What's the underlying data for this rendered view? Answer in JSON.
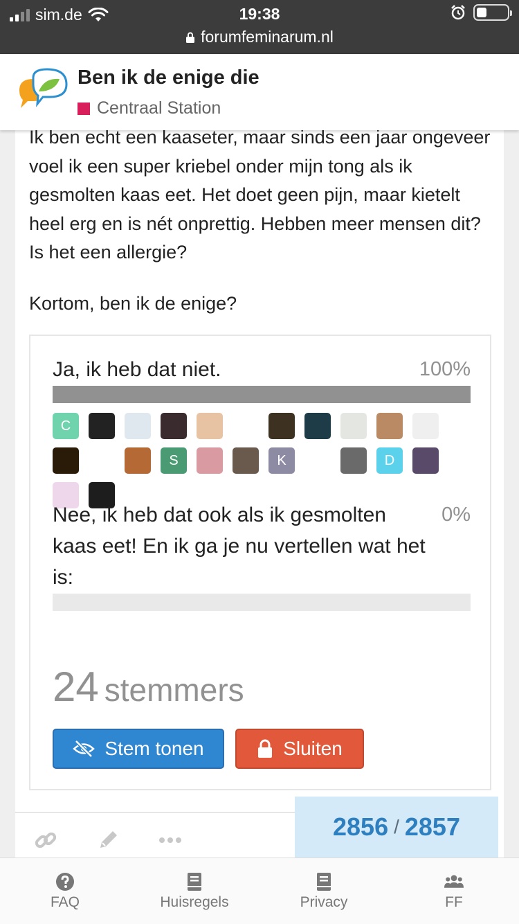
{
  "status_bar": {
    "carrier": "sim.de",
    "time": "19:38",
    "url": "forumfeminarum.nl"
  },
  "topic": {
    "title": "Ben ik de enige die",
    "category": "Centraal Station",
    "category_color": "#d81e5b"
  },
  "post": {
    "paragraph_1": "Ik ben echt een kaaseter, maar sinds een jaar ongeveer voel ik een super kriebel onder mijn tong als ik gesmolten kaas eet. Het doet geen pijn, maar kietelt heel erg en is nét onprettig. Hebben meer mensen dit? Is het een allergie?",
    "paragraph_2": "Kortom, ben ik de enige?"
  },
  "poll": {
    "options": [
      {
        "label": "Ja, ik heb dat niet.",
        "percent_text": "100%",
        "percent": 100
      },
      {
        "label": "Nee, ik heb dat ook als ik gesmolten kaas eet! En ik ga je nu vertellen wat het is:",
        "percent_text": "0%",
        "percent": 0
      }
    ],
    "voters": [
      {
        "letter": "C",
        "color": "#6fd3ad"
      },
      {
        "letter": "",
        "color": "#222222"
      },
      {
        "letter": "",
        "color": "#dfe7ef"
      },
      {
        "letter": "",
        "color": "#3a2c2e"
      },
      {
        "letter": "",
        "color": "#e7c3a3"
      },
      {
        "letter": "",
        "color": "#ffffff"
      },
      {
        "letter": "",
        "color": "#3d3222"
      },
      {
        "letter": "",
        "color": "#1e3b48"
      },
      {
        "letter": "",
        "color": "#e4e7e1"
      },
      {
        "letter": "",
        "color": "#b98a63"
      },
      {
        "letter": "",
        "color": "#efefef"
      },
      {
        "letter": "",
        "color": "#2a1a08"
      },
      {
        "letter": "",
        "color": "#ffffff"
      },
      {
        "letter": "",
        "color": "#b56a36"
      },
      {
        "letter": "S",
        "color": "#4a9a73"
      },
      {
        "letter": "",
        "color": "#d99aa2"
      },
      {
        "letter": "",
        "color": "#6a5a4e"
      },
      {
        "letter": "K",
        "color": "#8d8aa4"
      },
      {
        "letter": "",
        "color": "#ffffff"
      },
      {
        "letter": "",
        "color": "#6a6a6a"
      },
      {
        "letter": "D",
        "color": "#5bd1ec"
      },
      {
        "letter": "",
        "color": "#5a4a6a"
      },
      {
        "letter": "",
        "color": "#eed7ea"
      },
      {
        "letter": "",
        "color": "#1d1d1d"
      }
    ],
    "voter_count": "24",
    "voter_word": "stemmers",
    "show_votes_label": "Stem tonen",
    "close_label": "Sluiten"
  },
  "progress": {
    "current": "2856",
    "separator": "/",
    "total": "2857"
  },
  "bottom_nav": [
    {
      "label": "FAQ",
      "icon": "question-circle-icon"
    },
    {
      "label": "Huisregels",
      "icon": "book-icon"
    },
    {
      "label": "Privacy",
      "icon": "book-icon"
    },
    {
      "label": "FF",
      "icon": "users-icon"
    }
  ]
}
